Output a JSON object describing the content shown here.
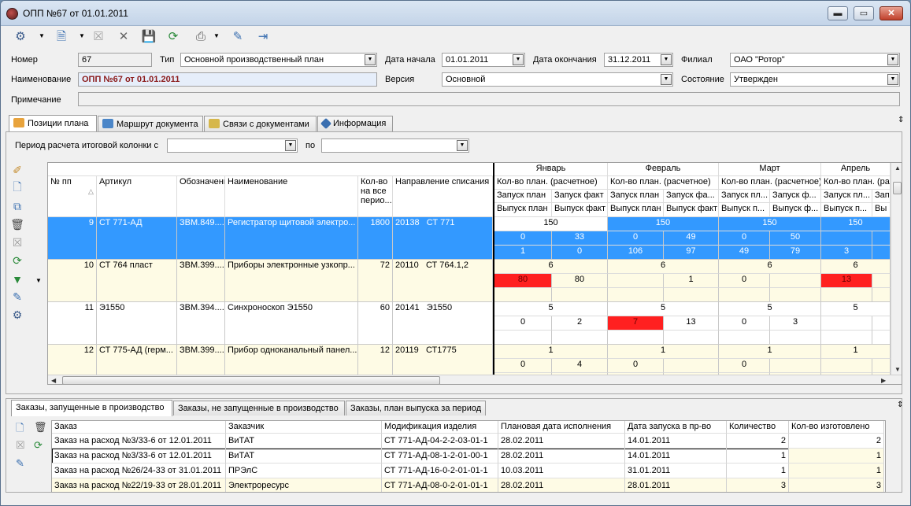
{
  "window": {
    "title": "ОПП №67 от 01.01.2011",
    "minimize": "▬",
    "maximize": "▭",
    "close": "✕"
  },
  "toolbar": {
    "icons": [
      "settings-icon",
      "document-icon",
      "cancel-icon",
      "delete-icon",
      "save-icon",
      "refresh-icon",
      "print-icon",
      "edit-icon",
      "export-icon"
    ]
  },
  "header": {
    "number_label": "Номер",
    "number_value": "67",
    "type_label": "Тип",
    "type_value": "Основной производственный план",
    "date_start_label": "Дата начала",
    "date_start_value": "01.01.2011",
    "date_end_label": "Дата окончания",
    "date_end_value": "31.12.2011",
    "branch_label": "Филиал",
    "branch_value": "ОАО \"Ротор\"",
    "name_label": "Наименование",
    "name_value": "ОПП №67 от 01.01.2011",
    "version_label": "Версия",
    "version_value": "Основной",
    "state_label": "Состояние",
    "state_value": "Утвержден",
    "note_label": "Примечание",
    "note_value": ""
  },
  "tabs": [
    {
      "label": "Позиции плана",
      "icon_color": "#e8a33c"
    },
    {
      "label": "Маршрут документа",
      "icon_color": "#4b86c8"
    },
    {
      "label": "Связи с документами",
      "icon_color": "#d6b74b"
    },
    {
      "label": "Информация",
      "icon_color": "#3a6fb0"
    }
  ],
  "period": {
    "label": "Период расчета итоговой колонки с",
    "from_value": "",
    "to_label": "по",
    "to_value": ""
  },
  "grid": {
    "columns": [
      "№ пп",
      "Артикул",
      "Обозначение",
      "Наименование",
      "Кол-во на все перио...",
      "Направление списания"
    ],
    "months": [
      "Январь",
      "Февраль",
      "Март",
      "Апрель"
    ],
    "sub_plan": [
      "Кол-во план. (расчетное)",
      "Кол-во план. (расчетное)",
      "Кол-во план. (расчетное)",
      "Кол-во план. (ра"
    ],
    "sub_launch": [
      [
        "Запуск план",
        "Запуск факт"
      ],
      [
        "Запуск план",
        "Запуск фа..."
      ],
      [
        "Запуск пл...",
        "Запуск ф..."
      ],
      [
        "Запуск пл...",
        "Зап"
      ]
    ],
    "sub_release": [
      [
        "Выпуск план",
        "Выпуск факт"
      ],
      [
        "Выпуск план",
        "Выпуск факт"
      ],
      [
        "Выпуск п...",
        "Выпуск ф..."
      ],
      [
        "Выпуск п...",
        "Вы"
      ]
    ],
    "rows": [
      {
        "no": "9",
        "article": "СТ 771-АД",
        "code": "ЗВМ.849....",
        "name": "Регистратор щитовой электро...",
        "qty": "1800",
        "dir_code": "20138",
        "dir_name": "СТ 771",
        "selected": true,
        "months": [
          {
            "plan": "150",
            "lp": "0",
            "lf": "33",
            "rp": "1",
            "rf": "0"
          },
          {
            "plan": "150",
            "lp": "0",
            "lf": "49",
            "rp": "106",
            "rf": "97"
          },
          {
            "plan": "150",
            "lp": "0",
            "lf": "50",
            "rp": "49",
            "rf": "79"
          },
          {
            "plan": "150",
            "lp": "",
            "lf": "",
            "rp": "3",
            "rf": ""
          }
        ]
      },
      {
        "no": "10",
        "article": "СТ 764 пласт",
        "code": "ЗВМ.399....",
        "name": "Приборы электронные узкопр...",
        "qty": "72",
        "dir_code": "20110",
        "dir_name": "СТ 764.1,2",
        "selected": false,
        "months": [
          {
            "plan": "6",
            "lp": "80",
            "lf": "80",
            "rp": "",
            "rf": "",
            "lp_red": true
          },
          {
            "plan": "6",
            "lp": "",
            "lf": "1",
            "rp": "",
            "rf": ""
          },
          {
            "plan": "6",
            "lp": "0",
            "lf": "",
            "rp": "",
            "rf": ""
          },
          {
            "plan": "6",
            "lp": "13",
            "lf": "",
            "rp": "",
            "rf": "",
            "lp_red": true
          }
        ]
      },
      {
        "no": "11",
        "article": "Э1550",
        "code": "ЗВМ.394....",
        "name": "Синхроноскоп Э1550",
        "qty": "60",
        "dir_code": "20141",
        "dir_name": "Э1550",
        "selected": false,
        "months": [
          {
            "plan": "5",
            "lp": "0",
            "lf": "2",
            "rp": "",
            "rf": ""
          },
          {
            "plan": "5",
            "lp": "7",
            "lf": "13",
            "rp": "",
            "rf": "",
            "lp_red": true
          },
          {
            "plan": "5",
            "lp": "0",
            "lf": "3",
            "rp": "",
            "rf": ""
          },
          {
            "plan": "5",
            "lp": "",
            "lf": "",
            "rp": "",
            "rf": ""
          }
        ]
      },
      {
        "no": "12",
        "article": "СТ 775-АД (герм...",
        "code": "ЗВМ.399....",
        "name": "Прибор одноканальный панел...",
        "qty": "12",
        "dir_code": "20119",
        "dir_name": "СТ1775",
        "selected": false,
        "months": [
          {
            "plan": "1",
            "lp": "0",
            "lf": "4",
            "rp": "",
            "rf": ""
          },
          {
            "plan": "1",
            "lp": "0",
            "lf": "",
            "rp": "",
            "rf": ""
          },
          {
            "plan": "1",
            "lp": "0",
            "lf": "",
            "rp": "",
            "rf": ""
          },
          {
            "plan": "1",
            "lp": "",
            "lf": "",
            "rp": "",
            "rf": ""
          }
        ]
      }
    ]
  },
  "bottom_tabs": [
    "Заказы, запущенные в производство",
    "Заказы, не запущенные в производство",
    "Заказы, план выпуска за период"
  ],
  "orders": {
    "columns": [
      "Заказ",
      "Заказчик",
      "Модификация изделия",
      "Плановая дата исполнения",
      "Дата запуска в пр-во",
      "Количество",
      "Кол-во изготовлено"
    ],
    "rows": [
      [
        "Заказ на расход №3/33-6 от 12.01.2011",
        "ВиТАТ",
        "СТ 771-АД-04-2-2-03-01-1",
        "28.02.2011",
        "14.01.2011",
        "2",
        "2"
      ],
      [
        "Заказ на расход №3/33-6 от 12.01.2011",
        "ВиТАТ",
        "СТ 771-АД-08-1-2-01-00-1",
        "28.02.2011",
        "14.01.2011",
        "1",
        "1"
      ],
      [
        "Заказ на расход №26/24-33 от 31.01.2011",
        "ПРЭлС",
        "СТ 771-АД-16-0-2-01-01-1",
        "10.03.2011",
        "31.01.2011",
        "1",
        "1"
      ],
      [
        "Заказ на расход №22/19-33 от 28.01.2011",
        "Электроресурс",
        "СТ 771-АД-08-0-2-01-01-1",
        "28.02.2011",
        "28.01.2011",
        "3",
        "3"
      ]
    ]
  },
  "colors": {
    "selection": "#3399ff",
    "row_alt": "#fefbe5",
    "red_cell": "#ff2020",
    "name_field": "#e6eefa"
  }
}
